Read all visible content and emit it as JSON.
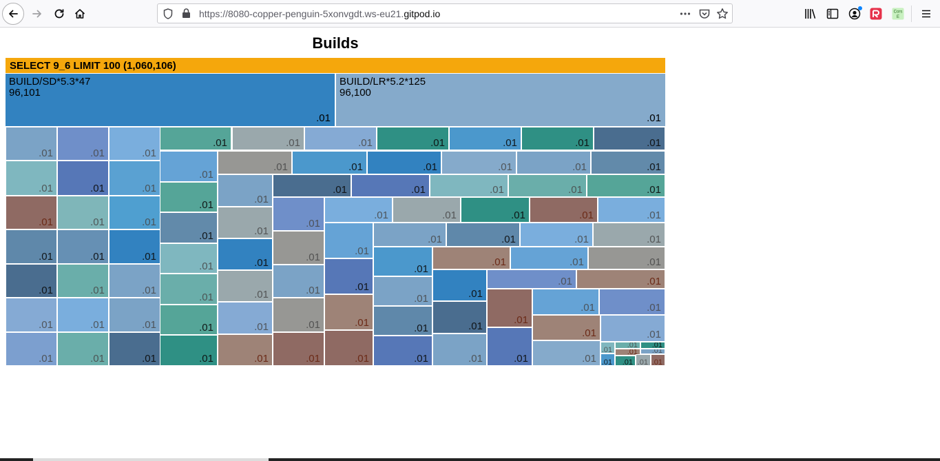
{
  "browser": {
    "url_prefix": "https://8080-copper-penguin-5xonvgdt.ws-eu21.",
    "url_domain": "gitpod.io",
    "url_suffix": "",
    "cors_label": "Cors E",
    "icons": [
      "back-icon",
      "forward-icon",
      "reload-icon",
      "home-icon",
      "shield-icon",
      "lock-icon",
      "more-icon",
      "pocket-icon",
      "star-icon",
      "library-icon",
      "sidebar-icon",
      "account-icon",
      "extension-icon",
      "cors-icon",
      "menu-icon"
    ]
  },
  "page": {
    "title": "Builds",
    "header": "SELECT 9_6 LIMIT 100 (1,060,106)"
  },
  "top_blocks": [
    {
      "label": "BUILD/SD*5.3*47",
      "count": "96,101",
      "value": ".01",
      "color": "#3282c0"
    },
    {
      "label": "BUILD/LR*5.2*125",
      "count": "96,100",
      "value": ".01",
      "color": "#85aacb"
    }
  ],
  "cells": {
    "value": ".01",
    "colors": [
      "#7ba3c6",
      "#7fb7bf",
      "#8f6a63",
      "#5f88aa",
      "#4a6d8f",
      "#85aad4",
      "#7c9fcf",
      "#6f8fc9",
      "#5677b7",
      "#7fb6b9",
      "#6690b4",
      "#6aaeaa",
      "#7aaedd",
      "#6aaeaa",
      "#7aaedd",
      "#5aa1d2",
      "#4f9fd0",
      "#3282c0",
      "#7ba3c6",
      "#7ba3c6",
      "#4a6d8f",
      "#55a598",
      "#65a3d6",
      "#55a598",
      "#628aaa",
      "#7fb7bf",
      "#6aaeaa",
      "#55a598",
      "#2f9084",
      "#9aa8ac",
      "#85aad4",
      "#2f9084",
      "#4b98cc",
      "#2f9084",
      "#4a6d8f",
      "#979794",
      "#4b98cc",
      "#3282c0",
      "#85aacb",
      "#7ba3c6",
      "#628aaa",
      "#7ba3c6",
      "#9aa8ac",
      "#3282c0",
      "#9aa8ac",
      "#85aad4",
      "#9e8377",
      "#4a6d8f",
      "#5677b7",
      "#7fb7bf",
      "#6aaeaa",
      "#55a598",
      "#6f8fc9",
      "#979794",
      "#7ba3c6",
      "#979794",
      "#8f6a63",
      "#7aaedd",
      "#9aa8ac",
      "#2f9084",
      "#8f6a63",
      "#7aaedd",
      "#65a3d6",
      "#5677b7",
      "#9e8377",
      "#8f6a63",
      "#7ba3c6",
      "#5f88aa",
      "#7aaedd",
      "#9aa8ac",
      "#4b98cc",
      "#7ba3c6",
      "#5f88aa",
      "#5677b7",
      "#9e8377",
      "#65a3d6",
      "#979794",
      "#3282c0",
      "#4a6d8f",
      "#7ba3c6",
      "#6f8fc9",
      "#9e8377",
      "#8f6a63",
      "#5677b7",
      "#65a3d6",
      "#6f8fc9",
      "#9e8377",
      "#85aacb",
      "#85aad4",
      "#7fb7bf",
      "#6aaeaa",
      "#2f9084",
      "#9e8377",
      "#7ba3c6",
      "#4b98cc",
      "#2f9084",
      "#9aa8ac",
      "#8f6a63",
      "#65a3d6",
      "#4b98cc"
    ]
  }
}
